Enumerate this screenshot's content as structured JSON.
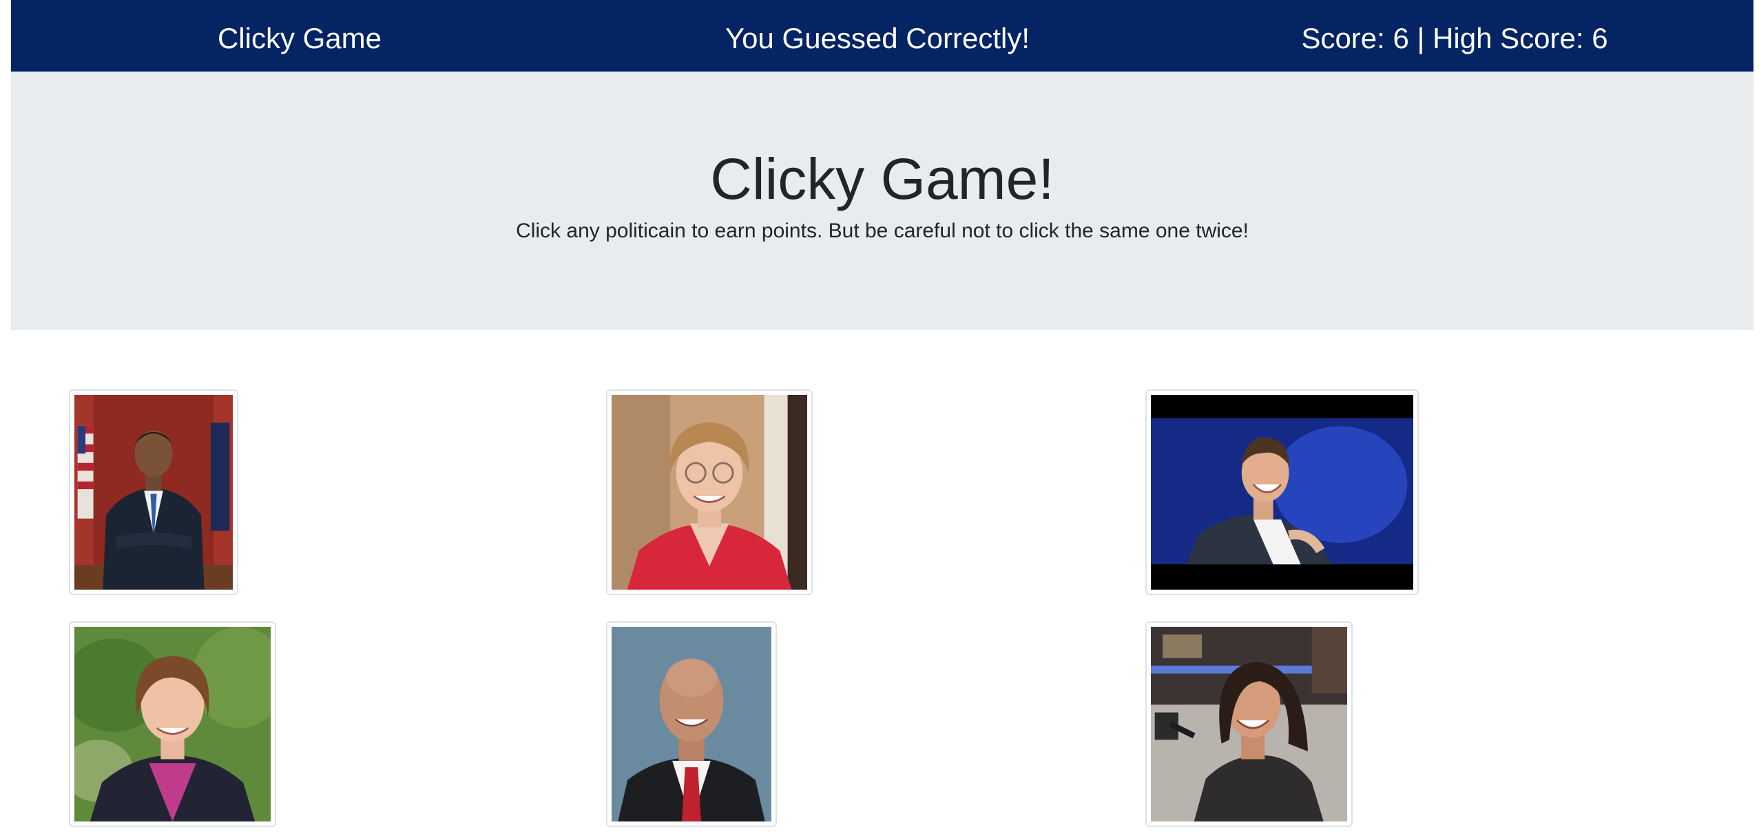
{
  "navbar": {
    "brand": "Clicky Game",
    "status": "You Guessed Correctly!",
    "score_text": "Score: 6 | High Score: 6"
  },
  "jumbotron": {
    "title": "Clicky Game!",
    "lead": "Click any politicain to earn points. But be careful not to click the same one twice!"
  },
  "colors": {
    "navbar_bg": "#042463",
    "jumbotron_bg": "#e9ecef",
    "card_border": "#dee2e6"
  }
}
